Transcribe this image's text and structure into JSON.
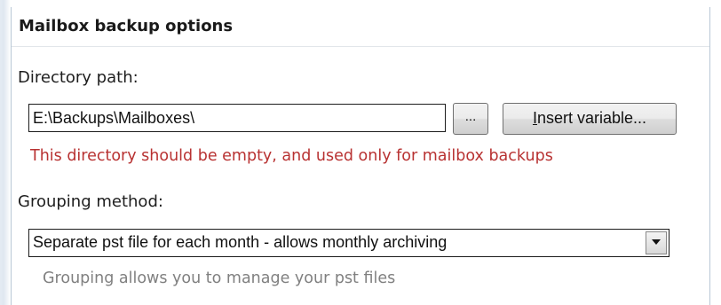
{
  "panel": {
    "title": "Mailbox backup options"
  },
  "directory": {
    "label": "Directory path:",
    "value": "E:\\Backups\\Mailboxes\\",
    "browse_label": "...",
    "insert_label_underlined": "I",
    "insert_label_rest": "nsert variable...",
    "warning": "This directory should be empty, and used only for mailbox backups"
  },
  "grouping": {
    "label": "Grouping method:",
    "selected": "Separate pst file for each month - allows monthly archiving",
    "hint": "Grouping allows you to manage your pst files"
  },
  "icons": {
    "dropdown": "chevron-down-icon"
  },
  "colors": {
    "warning": "#b83232",
    "hint": "#808080"
  }
}
